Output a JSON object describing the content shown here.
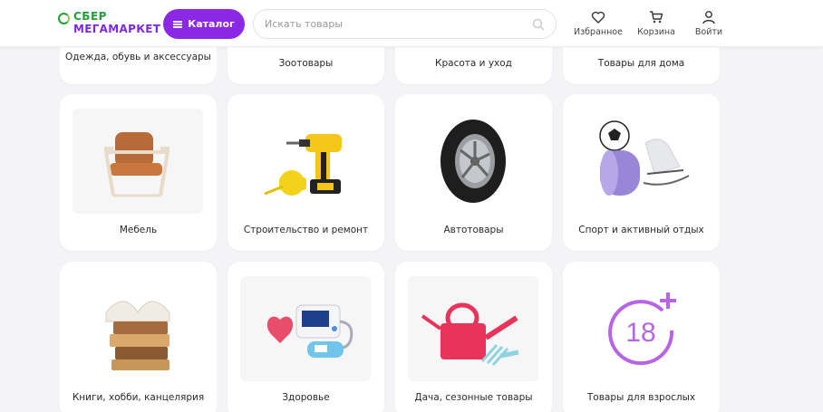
{
  "header": {
    "logo_top": "СБЕР",
    "logo_bottom": "МЕГАМАРКЕТ",
    "catalog_label": "Каталог",
    "search_placeholder": "Искать товары",
    "actions": [
      {
        "label": "Избранное",
        "icon": "heart-icon"
      },
      {
        "label": "Корзина",
        "icon": "cart-icon"
      },
      {
        "label": "Войти",
        "icon": "user-icon"
      }
    ]
  },
  "colors": {
    "brand_purple": "#8b28e5",
    "brand_green": "#21a038"
  },
  "categories": {
    "row1": [
      {
        "label": "Одежда, обувь и аксессуары"
      },
      {
        "label": "Зоотовары"
      },
      {
        "label": "Красота и уход"
      },
      {
        "label": "Товары для дома"
      }
    ],
    "row2": [
      {
        "label": "Мебель",
        "icon": "armchair-image"
      },
      {
        "label": "Строительство и ремонт",
        "icon": "drill-image"
      },
      {
        "label": "Автотовары",
        "icon": "tire-image"
      },
      {
        "label": "Спорт и активный отдых",
        "icon": "sport-gear-image"
      }
    ],
    "row3": [
      {
        "label": "Книги, хобби, канцелярия",
        "icon": "books-image"
      },
      {
        "label": "Здоровье",
        "icon": "health-devices-image"
      },
      {
        "label": "Дача, сезонные товары",
        "icon": "watering-can-image"
      },
      {
        "label": "Товары для взрослых",
        "icon": "adult-18-image",
        "badge": "18"
      }
    ]
  }
}
